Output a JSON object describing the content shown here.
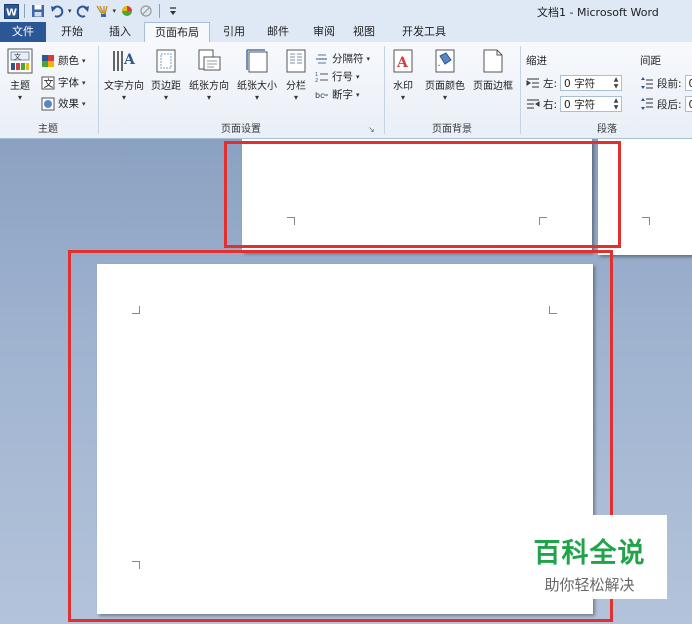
{
  "window": {
    "title": "文档1 - Microsoft Word",
    "app_icon": "word-icon",
    "quick_access": [
      "save-icon",
      "undo-icon",
      "redo-icon",
      "format-painter-icon",
      "color-icon",
      "clear-icon",
      "customize-icon"
    ]
  },
  "tabs": [
    {
      "label": "文件"
    },
    {
      "label": "开始"
    },
    {
      "label": "插入"
    },
    {
      "label": "页面布局"
    },
    {
      "label": "引用"
    },
    {
      "label": "邮件"
    },
    {
      "label": "审阅"
    },
    {
      "label": "视图"
    },
    {
      "label": "开发工具"
    }
  ],
  "ribbon": {
    "theme_group": {
      "label": "主题",
      "theme_button": "主题",
      "colors": "颜色",
      "fonts": "字体",
      "effects": "效果"
    },
    "page_setup_group": {
      "label": "页面设置",
      "text_direction": "文字方向",
      "margins": "页边距",
      "orientation": "纸张方向",
      "size": "纸张大小",
      "columns": "分栏",
      "breaks": "分隔符",
      "line_numbers": "行号",
      "hyphenation": "断字"
    },
    "page_background_group": {
      "label": "页面背景",
      "watermark": "水印",
      "page_color": "页面颜色",
      "page_borders": "页面边框"
    },
    "paragraph_group": {
      "label": "段落",
      "indent_label": "缩进",
      "left_label": "左:",
      "left_value": "0 字符",
      "right_label": "右:",
      "right_value": "0 字符",
      "spacing_label": "间距",
      "before_label": "段前:",
      "before_value": "0",
      "after_label": "段后:",
      "after_value": "0"
    }
  },
  "overlay": {
    "brand": "百科全说",
    "slogan": "助你轻松解决",
    "brand_color": "#21a34a",
    "highlight_color": "#e0302f"
  }
}
